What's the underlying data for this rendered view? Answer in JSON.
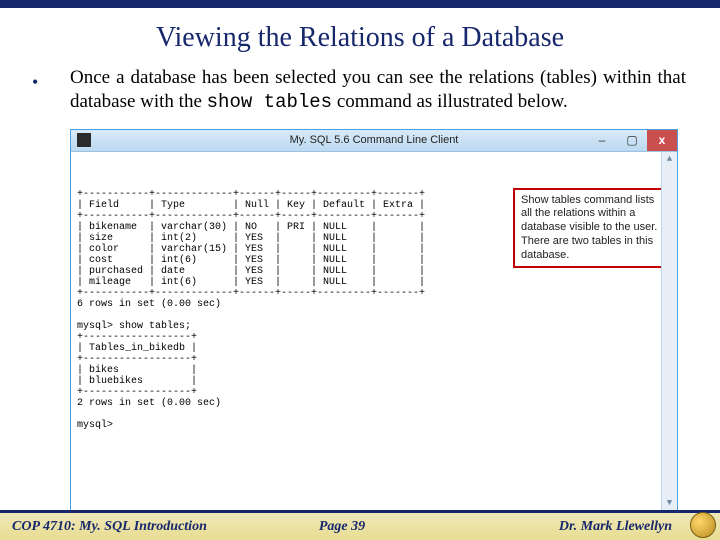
{
  "slide": {
    "title": "Viewing the Relations of a Database",
    "bullet_pre": "Once a database has been selected you can see the relations (tables) within that database with the ",
    "bullet_code": "show tables",
    "bullet_post": " command as illustrated below."
  },
  "window": {
    "title": "My. SQL 5.6 Command Line Client",
    "buttons": {
      "min": "–",
      "max": "▢",
      "close": "x"
    }
  },
  "console": {
    "describe_header": "| Field     | Type        | Null | Key | Default | Extra |",
    "rows": [
      "| bikename  | varchar(30) | NO   | PRI | NULL    |       |",
      "| size      | int(2)      | YES  |     | NULL    |       |",
      "| color     | varchar(15) | YES  |     | NULL    |       |",
      "| cost      | int(6)      | YES  |     | NULL    |       |",
      "| purchased | date        | YES  |     | NULL    |       |",
      "| mileage   | int(6)      | YES  |     | NULL    |       |"
    ],
    "rows_summary": "6 rows in set (0.00 sec)",
    "prompt_show": "mysql> show tables;",
    "tables_header": "| Tables_in_bikedb |",
    "tables_rows": [
      "| bikes            |",
      "| bluebikes        |"
    ],
    "tables_summary": "2 rows in set (0.00 sec)",
    "prompt_end": "mysql>"
  },
  "callout": {
    "text": "Show tables command lists all the relations within a database visible to the user. There are two tables in this database."
  },
  "footer": {
    "left": "COP 4710: My. SQL Introduction",
    "center": "Page 39",
    "right": "Dr. Mark Llewellyn"
  }
}
